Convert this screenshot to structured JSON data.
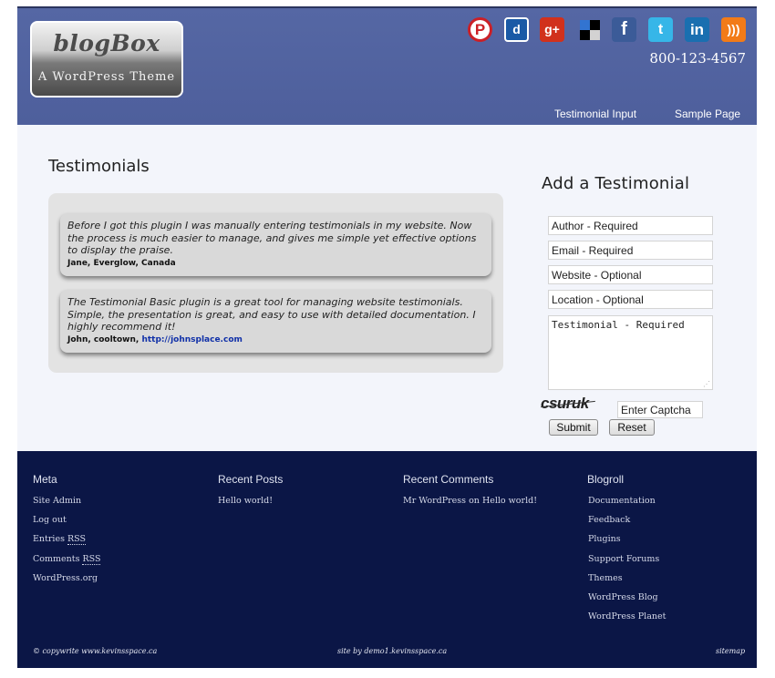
{
  "header": {
    "logo_title": "blogBox",
    "logo_subtitle": "A WordPress Theme",
    "phone": "800-123-4567",
    "nav": [
      "Testimonial Input",
      "Sample Page"
    ],
    "social_icons": [
      "pinterest-icon",
      "digg-icon",
      "google-plus-icon",
      "delicious-icon",
      "facebook-icon",
      "twitter-icon",
      "linkedin-icon",
      "rss-icon"
    ]
  },
  "main": {
    "page_title": "Testimonials",
    "testimonials": [
      {
        "quote": "Before I got this plugin I was manually entering testimonials in my website. Now the process is much easier to manage, and gives me simple yet effective options to display the praise.",
        "author": "Jane, Everglow, Canada",
        "link": ""
      },
      {
        "quote": "The Testimonial Basic plugin is a great tool for managing website testimonials. Simple, the presentation is great, and easy to use with detailed documentation. I highly recommend it!",
        "author": "John, cooltown, ",
        "link": "http://johnsplace.com"
      }
    ]
  },
  "form": {
    "title": "Add a Testimonial",
    "author_placeholder": "Author - Required",
    "email_placeholder": "Email - Required",
    "website_placeholder": "Website - Optional",
    "location_placeholder": "Location - Optional",
    "testimonial_placeholder": "Testimonial - Required",
    "captcha_text": "csuruk",
    "captcha_placeholder": "Enter Captcha",
    "submit_label": "Submit",
    "reset_label": "Reset"
  },
  "footer": {
    "meta": {
      "heading": "Meta",
      "items": [
        "Site Admin",
        "Log out",
        "Entries ",
        "RSS",
        "Comments ",
        "RSS",
        "WordPress.org"
      ]
    },
    "recent_posts": {
      "heading": "Recent Posts",
      "items": [
        "Hello world!"
      ]
    },
    "recent_comments": {
      "heading": "Recent Comments",
      "author": "Mr WordPress",
      "on": " on ",
      "post": "Hello world!"
    },
    "blogroll": {
      "heading": "Blogroll",
      "items": [
        "Documentation",
        "Feedback",
        "Plugins",
        "Support Forums",
        "Themes",
        "WordPress Blog",
        "WordPress Planet"
      ]
    },
    "copyright": "© copywrite www.kevinsspace.ca",
    "site_by": "site by  demo1.kevinsspace.ca",
    "sitemap": "sitemap"
  },
  "colors": {
    "header_bg": "#5266a3",
    "content_bg": "#f3f5fb",
    "footer_bg": "#0b1646",
    "link": "#1030a8"
  }
}
